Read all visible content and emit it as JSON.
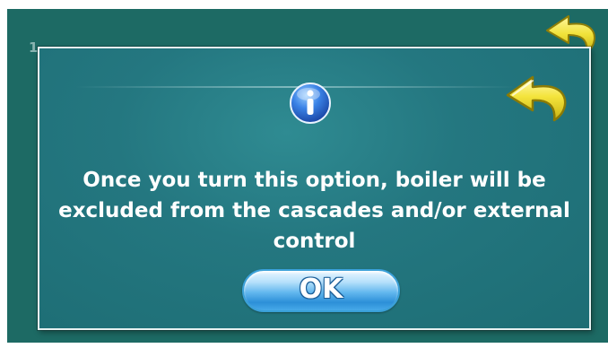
{
  "background": {
    "title": "1 ...",
    "back_icon": "back-arrow-icon"
  },
  "dialog": {
    "icon": "info-icon",
    "back_icon": "back-arrow-icon",
    "message": "Once you turn this option, boiler will be excluded from the cascades and/or external control",
    "ok_label": "OK"
  },
  "colors": {
    "screen_background": "#1d6a64",
    "dialog_background": "#247780",
    "dialog_border": "#e6f1f1",
    "message_text": "#ffffff",
    "ok_button": "#62b7ee",
    "back_arrow": "#f2e23a",
    "info_icon": "#2f6fd6"
  }
}
